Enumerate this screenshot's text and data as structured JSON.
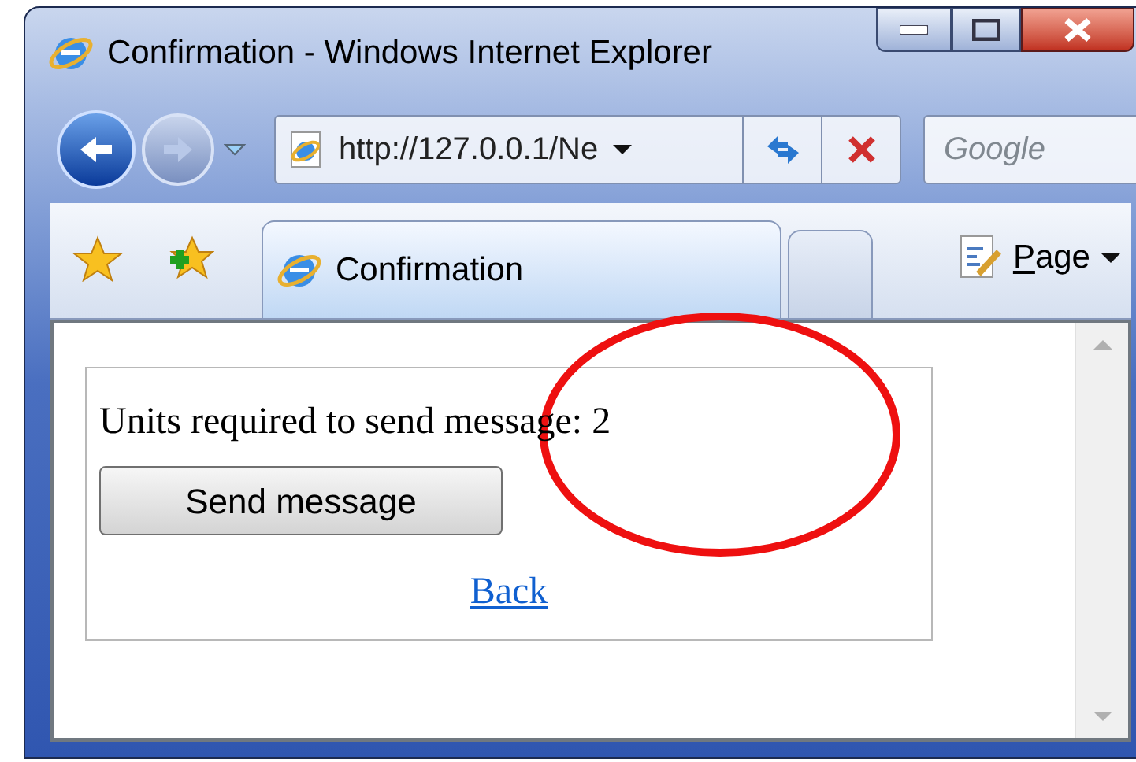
{
  "window": {
    "title": "Confirmation - Windows Internet Explorer"
  },
  "address_bar": {
    "value": "http://127.0.0.1/Ne"
  },
  "search": {
    "placeholder": "Google"
  },
  "tabs": [
    {
      "label": "Confirmation",
      "selected": true
    },
    {
      "selected": false
    }
  ],
  "toolbar": {
    "page_menu": "Page"
  },
  "content": {
    "message": "Units required to send message: 2",
    "button": "Send message",
    "link": "Back"
  }
}
